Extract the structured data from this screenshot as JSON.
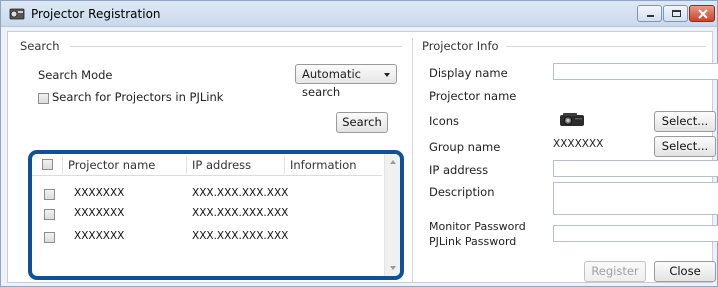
{
  "window": {
    "title": "Projector Registration"
  },
  "search": {
    "group_label": "Search",
    "mode_label": "Search Mode",
    "mode_value": "Automatic search",
    "pjlink_label": "Search for Projectors in PJLink",
    "search_button": "Search"
  },
  "list": {
    "headers": [
      "Projector name",
      "IP address",
      "Information"
    ],
    "rows": [
      {
        "name": "XXXXXXX",
        "ip": "XXX.XXX.XXX.XXX",
        "info": ""
      },
      {
        "name": "XXXXXXX",
        "ip": "XXX.XXX.XXX.XXX",
        "info": ""
      },
      {
        "name": "XXXXXXX",
        "ip": "XXX.XXX.XXX.XXX",
        "info": ""
      }
    ]
  },
  "info": {
    "group_label": "Projector Info",
    "display_name_label": "Display name",
    "projector_name_label": "Projector name",
    "icons_label": "Icons",
    "icons_select": "Select...",
    "group_name_label": "Group name",
    "group_name_value": "XXXXXXX",
    "group_select": "Select...",
    "ip_label": "IP address",
    "description_label": "Description",
    "monitor_password_label": "Monitor Password",
    "pjlink_password_label": "PJLink Password",
    "register_button": "Register",
    "close_button": "Close"
  },
  "colors": {
    "highlight": "#0e5196"
  },
  "icons": {
    "app": "projector-app-icon",
    "projector": "projector-icon"
  }
}
